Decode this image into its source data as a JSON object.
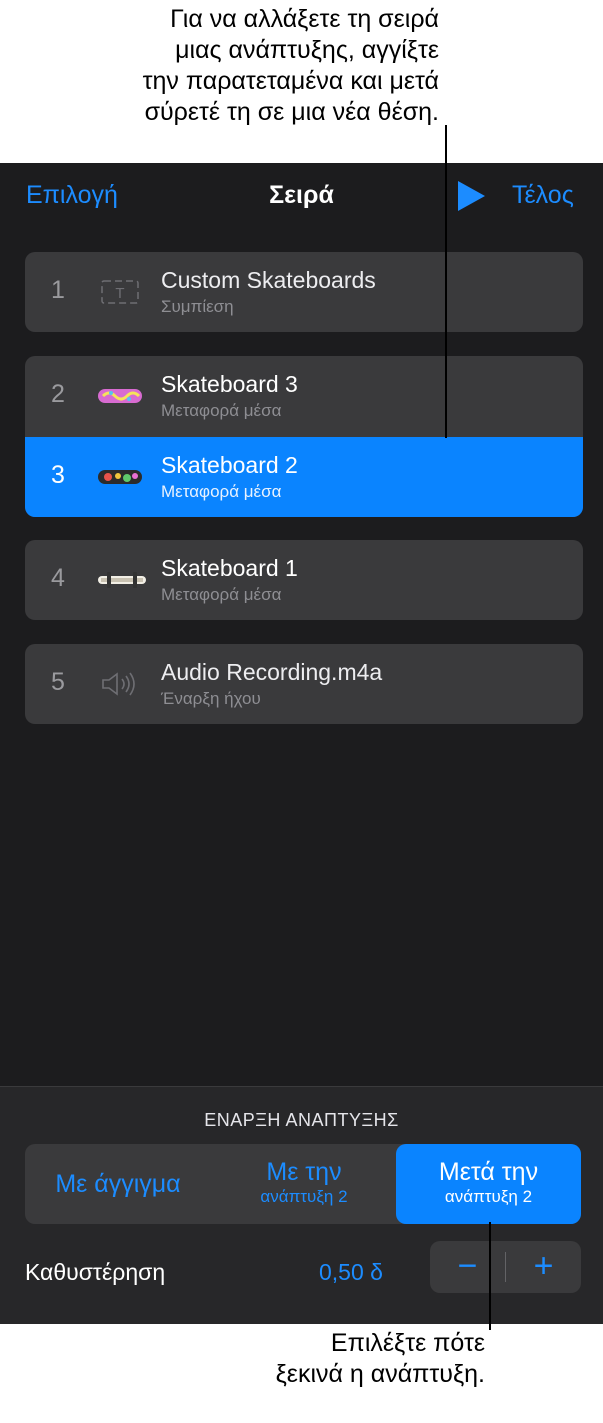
{
  "callouts": {
    "top": [
      "Για να αλλάξετε τη σειρά",
      "μιας ανάπτυξης, αγγίξτε",
      "την παρατεταμένα και μετά",
      "σύρετέ τη σε μια νέα θέση."
    ],
    "bottom": [
      "Επιλέξτε πότε",
      "ξεκινά η ανάπτυξη."
    ]
  },
  "nav": {
    "left": "Επιλογή",
    "title": "Σειρά",
    "play_icon": "play-icon",
    "right": "Τέλος"
  },
  "items": [
    {
      "num": "1",
      "title": "Custom Skateboards",
      "sub": "Συμπίεση",
      "icon": "text-box-icon"
    },
    {
      "num": "2",
      "title": "Skateboard 3",
      "sub": "Μεταφορά μέσα",
      "icon": "skateboard-thumbnail"
    },
    {
      "num": "3",
      "title": "Skateboard 2",
      "sub": "Μεταφορά μέσα",
      "icon": "skateboard-thumbnail"
    },
    {
      "num": "4",
      "title": "Skateboard 1",
      "sub": "Μεταφορά μέσα",
      "icon": "skateboard-thumbnail"
    },
    {
      "num": "5",
      "title": "Audio Recording.m4a",
      "sub": "Έναρξη ήχου",
      "icon": "speaker-icon"
    }
  ],
  "build_start": {
    "label": "ΕΝΑΡΞΗ ΑΝΑΠΤΥΞΗΣ",
    "options": [
      {
        "main": "Με άγγιγμα",
        "small": ""
      },
      {
        "main": "Με την",
        "small": "ανάπτυξη 2"
      },
      {
        "main": "Μετά την",
        "small": "ανάπτυξη 2"
      }
    ],
    "selected_index": 2
  },
  "delay": {
    "label": "Καθυστέρηση",
    "value": "0,50 δ",
    "minus": "−",
    "plus": "+"
  },
  "colors": {
    "accent": "#1c8cff",
    "selected": "#0a84ff",
    "panel": "#1c1c1e",
    "card": "#3a3a3c"
  }
}
